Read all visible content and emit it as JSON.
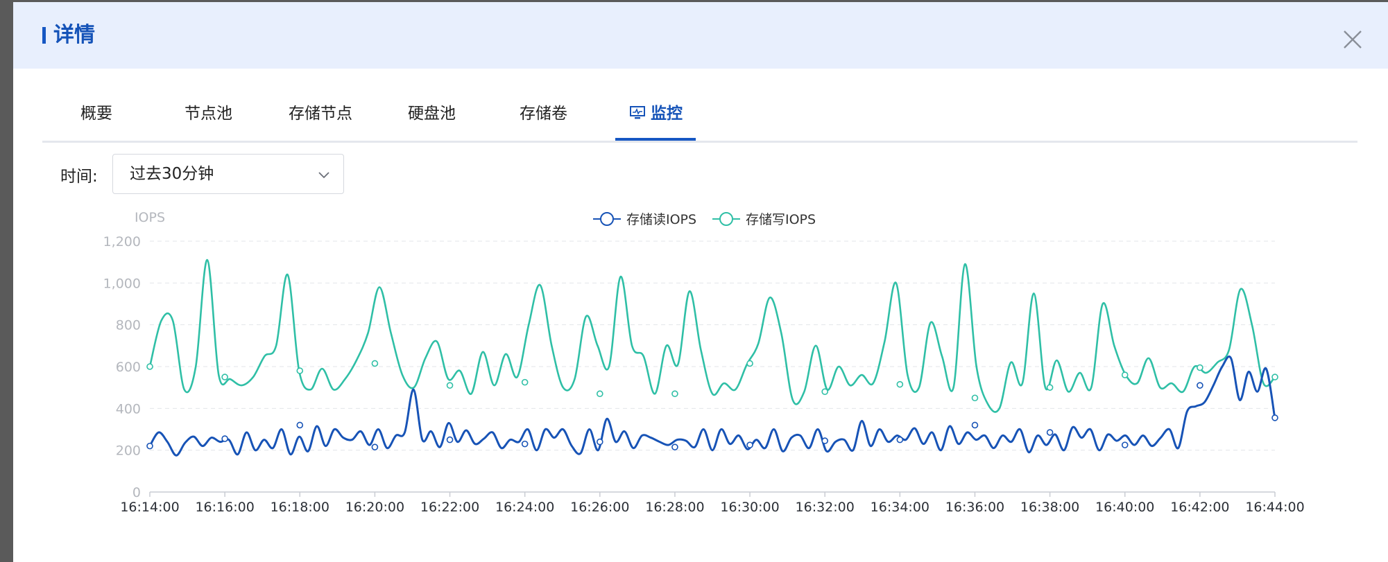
{
  "dialog": {
    "title": "详情"
  },
  "tabs": [
    {
      "label": "概要"
    },
    {
      "label": "节点池"
    },
    {
      "label": "存储节点"
    },
    {
      "label": "硬盘池"
    },
    {
      "label": "存储卷"
    },
    {
      "label": "监控",
      "active": true,
      "icon": "monitor-icon"
    }
  ],
  "filter": {
    "label": "时间:",
    "selected": "过去30分钟"
  },
  "colors": {
    "accent": "#1657c3",
    "read": "#1753b6",
    "write": "#2fbfa6"
  },
  "chart_data": {
    "type": "line",
    "ylabel": "IOPS",
    "ylim": [
      0,
      1200
    ],
    "yticks": [
      "0",
      "200",
      "400",
      "600",
      "800",
      "1,000",
      "1,200"
    ],
    "x_ticks": [
      "16:14:00",
      "16:16:00",
      "16:18:00",
      "16:20:00",
      "16:22:00",
      "16:24:00",
      "16:26:00",
      "16:28:00",
      "16:30:00",
      "16:32:00",
      "16:34:00",
      "16:36:00",
      "16:38:00",
      "16:40:00",
      "16:42:00",
      "16:44:00"
    ],
    "x_start": "16:14:00",
    "x_end": "16:44:00",
    "grid": true,
    "legend_position": "top-center",
    "series": [
      {
        "name": "存储读IOPS",
        "values": [
          220,
          285,
          240,
          175,
          235,
          265,
          220,
          260,
          240,
          250,
          180,
          285,
          200,
          250,
          210,
          300,
          180,
          265,
          195,
          315,
          220,
          300,
          260,
          250,
          290,
          225,
          300,
          210,
          270,
          285,
          490,
          250,
          290,
          215,
          330,
          240,
          295,
          230,
          255,
          285,
          210,
          250,
          240,
          300,
          200,
          300,
          260,
          300,
          220,
          185,
          300,
          200,
          350,
          240,
          290,
          210,
          270,
          260,
          240,
          225,
          250,
          245,
          215,
          300,
          200,
          300,
          230,
          270,
          205,
          250,
          210,
          300,
          195,
          260,
          270,
          210,
          300,
          195,
          240,
          250,
          200,
          340,
          220,
          300,
          240,
          270,
          250,
          305,
          230,
          285,
          200,
          315,
          230,
          285,
          250,
          270,
          210,
          270,
          240,
          300,
          190,
          270,
          225,
          275,
          200,
          310,
          260,
          300,
          200,
          275,
          245,
          270,
          225,
          270,
          220,
          260,
          300,
          210,
          385,
          410,
          430,
          510,
          600,
          640,
          440,
          575,
          480,
          590,
          350
        ],
        "markers": [
          [
            0,
            220
          ],
          [
            2,
            255
          ],
          [
            4,
            320
          ],
          [
            6,
            215
          ],
          [
            8,
            250
          ],
          [
            10,
            230
          ],
          [
            12,
            240
          ],
          [
            14,
            215
          ],
          [
            16,
            225
          ],
          [
            18,
            245
          ],
          [
            20,
            250
          ],
          [
            22,
            320
          ],
          [
            24,
            285
          ],
          [
            26,
            225
          ],
          [
            28,
            510
          ],
          [
            30,
            355
          ]
        ]
      },
      {
        "name": "存储写IOPS",
        "values": [
          600,
          820,
          820,
          490,
          600,
          1110,
          560,
          540,
          510,
          550,
          650,
          700,
          1040,
          580,
          490,
          590,
          490,
          540,
          630,
          760,
          980,
          760,
          560,
          500,
          640,
          720,
          540,
          580,
          470,
          670,
          510,
          660,
          550,
          800,
          990,
          700,
          500,
          540,
          840,
          700,
          600,
          1030,
          700,
          650,
          470,
          700,
          610,
          960,
          680,
          470,
          520,
          490,
          610,
          710,
          930,
          760,
          440,
          480,
          700,
          490,
          600,
          510,
          560,
          520,
          720,
          1000,
          560,
          500,
          810,
          650,
          500,
          1090,
          600,
          420,
          400,
          620,
          520,
          950,
          500,
          630,
          480,
          570,
          500,
          900,
          700,
          560,
          520,
          640,
          500,
          520,
          480,
          600,
          570,
          620,
          680,
          970,
          800,
          520,
          550
        ],
        "markers": [
          [
            0,
            600
          ],
          [
            2,
            550
          ],
          [
            4,
            580
          ],
          [
            6,
            615
          ],
          [
            8,
            510
          ],
          [
            10,
            525
          ],
          [
            12,
            470
          ],
          [
            14,
            470
          ],
          [
            16,
            615
          ],
          [
            18,
            480
          ],
          [
            20,
            515
          ],
          [
            22,
            450
          ],
          [
            24,
            500
          ],
          [
            26,
            560
          ],
          [
            28,
            595
          ],
          [
            30,
            550
          ]
        ]
      }
    ]
  }
}
